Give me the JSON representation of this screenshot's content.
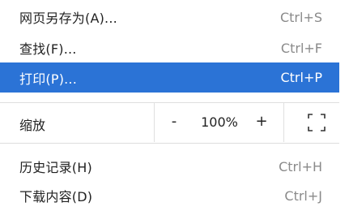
{
  "menu": {
    "items": [
      {
        "label": "网页另存为(A)...",
        "shortcut": "Ctrl+S"
      },
      {
        "label": "查找(F)...",
        "shortcut": "Ctrl+F"
      },
      {
        "label": "打印(P)...",
        "shortcut": "Ctrl+P",
        "highlighted": true
      },
      {
        "label": "历史记录(H)",
        "shortcut": "Ctrl+H"
      },
      {
        "label": "下载内容(D)",
        "shortcut": "Ctrl+J"
      }
    ],
    "zoom": {
      "label": "缩放",
      "minus": "-",
      "value": "100%",
      "plus": "+",
      "fullscreen_icon": "fullscreen-icon"
    }
  },
  "colors": {
    "highlight": "#2b73d6",
    "shortcut_text": "#8a8a8a",
    "separator": "#dedede"
  }
}
